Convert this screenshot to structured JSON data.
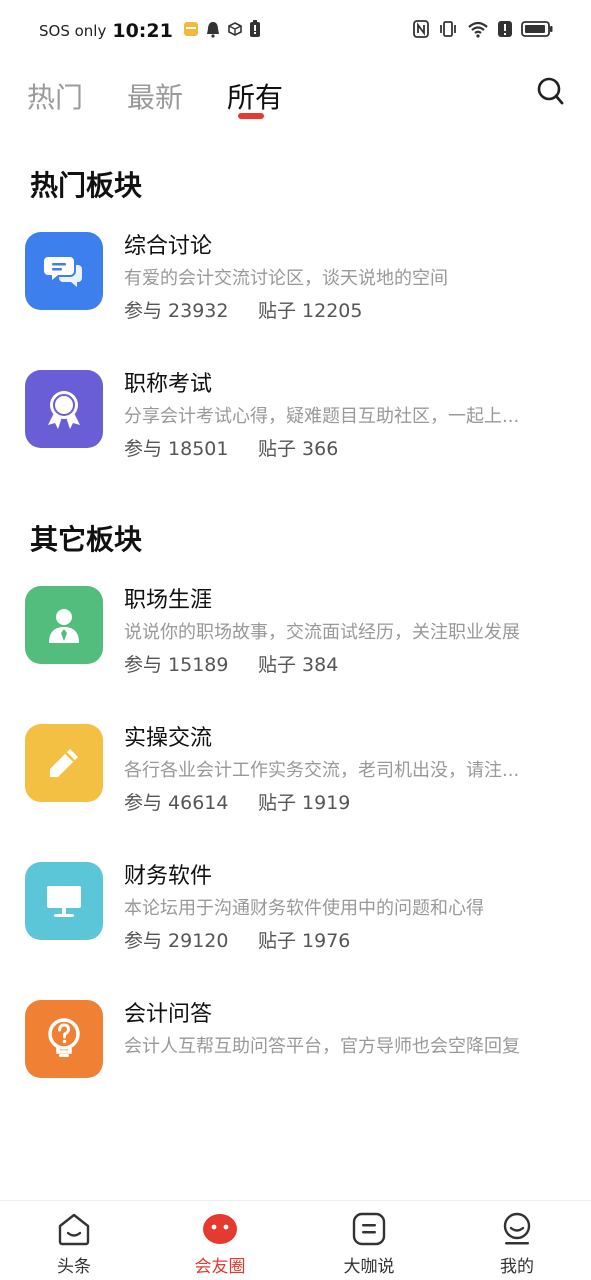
{
  "status_bar": {
    "carrier": "SOS only",
    "time": "10:21"
  },
  "tabs": [
    {
      "label": "热门",
      "active": false
    },
    {
      "label": "最新",
      "active": false
    },
    {
      "label": "所有",
      "active": true
    }
  ],
  "colors": {
    "accent": "#e53a2f",
    "icon_blue": "#3d7fec",
    "icon_purple": "#6a5ed6",
    "icon_green": "#52bd7c",
    "icon_yellow": "#f4c043",
    "icon_cyan": "#5ac6d8",
    "icon_orange": "#f08033"
  },
  "hot_section": {
    "title": "热门板块",
    "boards": [
      {
        "name": "综合讨论",
        "desc": "有爱的会计交流讨论区，谈天说地的空间",
        "join": "参与 23932",
        "posts": "贴子 12205",
        "icon": "chat-bubbles-icon"
      },
      {
        "name": "职称考试",
        "desc": "分享会计考试心得，疑难题目互助社区，一起上...",
        "join": "参与 18501",
        "posts": "贴子 366",
        "icon": "medal-icon"
      }
    ]
  },
  "other_section": {
    "title": "其它板块",
    "boards": [
      {
        "name": "职场生涯",
        "desc": "说说你的职场故事，交流面试经历，关注职业发展",
        "join": "参与 15189",
        "posts": "贴子 384",
        "icon": "person-tie-icon"
      },
      {
        "name": "实操交流",
        "desc": "各行各业会计工作实务交流，老司机出没，请注...",
        "join": "参与 46614",
        "posts": "贴子 1919",
        "icon": "pencil-icon"
      },
      {
        "name": "财务软件",
        "desc": "本论坛用于沟通财务软件使用中的问题和心得",
        "join": "参与 29120",
        "posts": "贴子 1976",
        "icon": "monitor-icon"
      },
      {
        "name": "会计问答",
        "desc": "会计人互帮互助问答平台，官方导师也会空降回复",
        "icon": "question-bulb-icon"
      }
    ]
  },
  "bottom_nav": [
    {
      "label": "头条",
      "icon": "home-icon",
      "active": false
    },
    {
      "label": "会友圈",
      "icon": "community-icon",
      "active": true
    },
    {
      "label": "大咖说",
      "icon": "talk-icon",
      "active": false
    },
    {
      "label": "我的",
      "icon": "profile-icon",
      "active": false
    }
  ]
}
